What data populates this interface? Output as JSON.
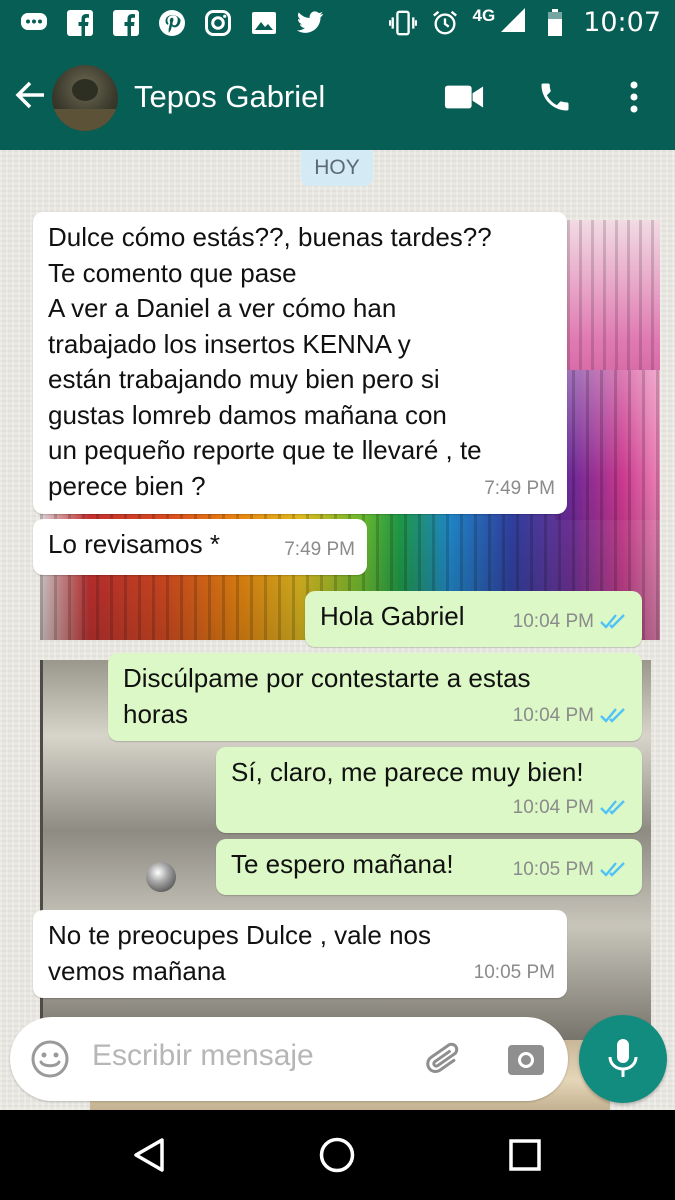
{
  "status_bar": {
    "time": "10:07",
    "network": "4G",
    "left_icons": [
      "chat-bubble-icon",
      "facebook-icon",
      "facebook-icon",
      "pinterest-icon",
      "instagram-icon",
      "image-icon",
      "twitter-icon"
    ],
    "right_icons": [
      "vibrate-icon",
      "alarm-icon",
      "signal-icon",
      "battery-icon"
    ]
  },
  "header": {
    "contact_name": "Tepos Gabriel"
  },
  "chat": {
    "day_label": "HOY",
    "messages": [
      {
        "direction": "in",
        "text": "Dulce cómo estás??, buenas tardes??\nTe comento que pase\nA ver a Daniel a ver cómo han\ntrabajado los insertos KENNA y\nestán trabajando muy bien pero si\ngustas lomreb damos mañana con\nun pequeño reporte que te llevaré , te\nperece bien ?",
        "time": "7:49 PM"
      },
      {
        "direction": "in",
        "text": "Lo revisamos *",
        "time": "7:49 PM"
      },
      {
        "direction": "out",
        "text": "Hola Gabriel",
        "time": "10:04 PM",
        "read": true
      },
      {
        "direction": "out",
        "text": "Discúlpame por contestarte a estas\nhoras",
        "time": "10:04 PM",
        "read": true
      },
      {
        "direction": "out",
        "text": "Sí, claro, me parece muy bien!",
        "time": "10:04 PM",
        "read": true
      },
      {
        "direction": "out",
        "text": "Te espero mañana!",
        "time": "10:05 PM",
        "read": true
      },
      {
        "direction": "in",
        "text": "No te preocupes Dulce , vale nos\nvemos mañana",
        "time": "10:05 PM"
      }
    ]
  },
  "composer": {
    "placeholder": "Escribir mensaje"
  },
  "colors": {
    "header_bg": "#075e54",
    "outgoing_bubble": "#dcf8c6",
    "incoming_bubble": "#ffffff",
    "read_ticks": "#4fc3f7",
    "mic_button": "#128c7e"
  }
}
